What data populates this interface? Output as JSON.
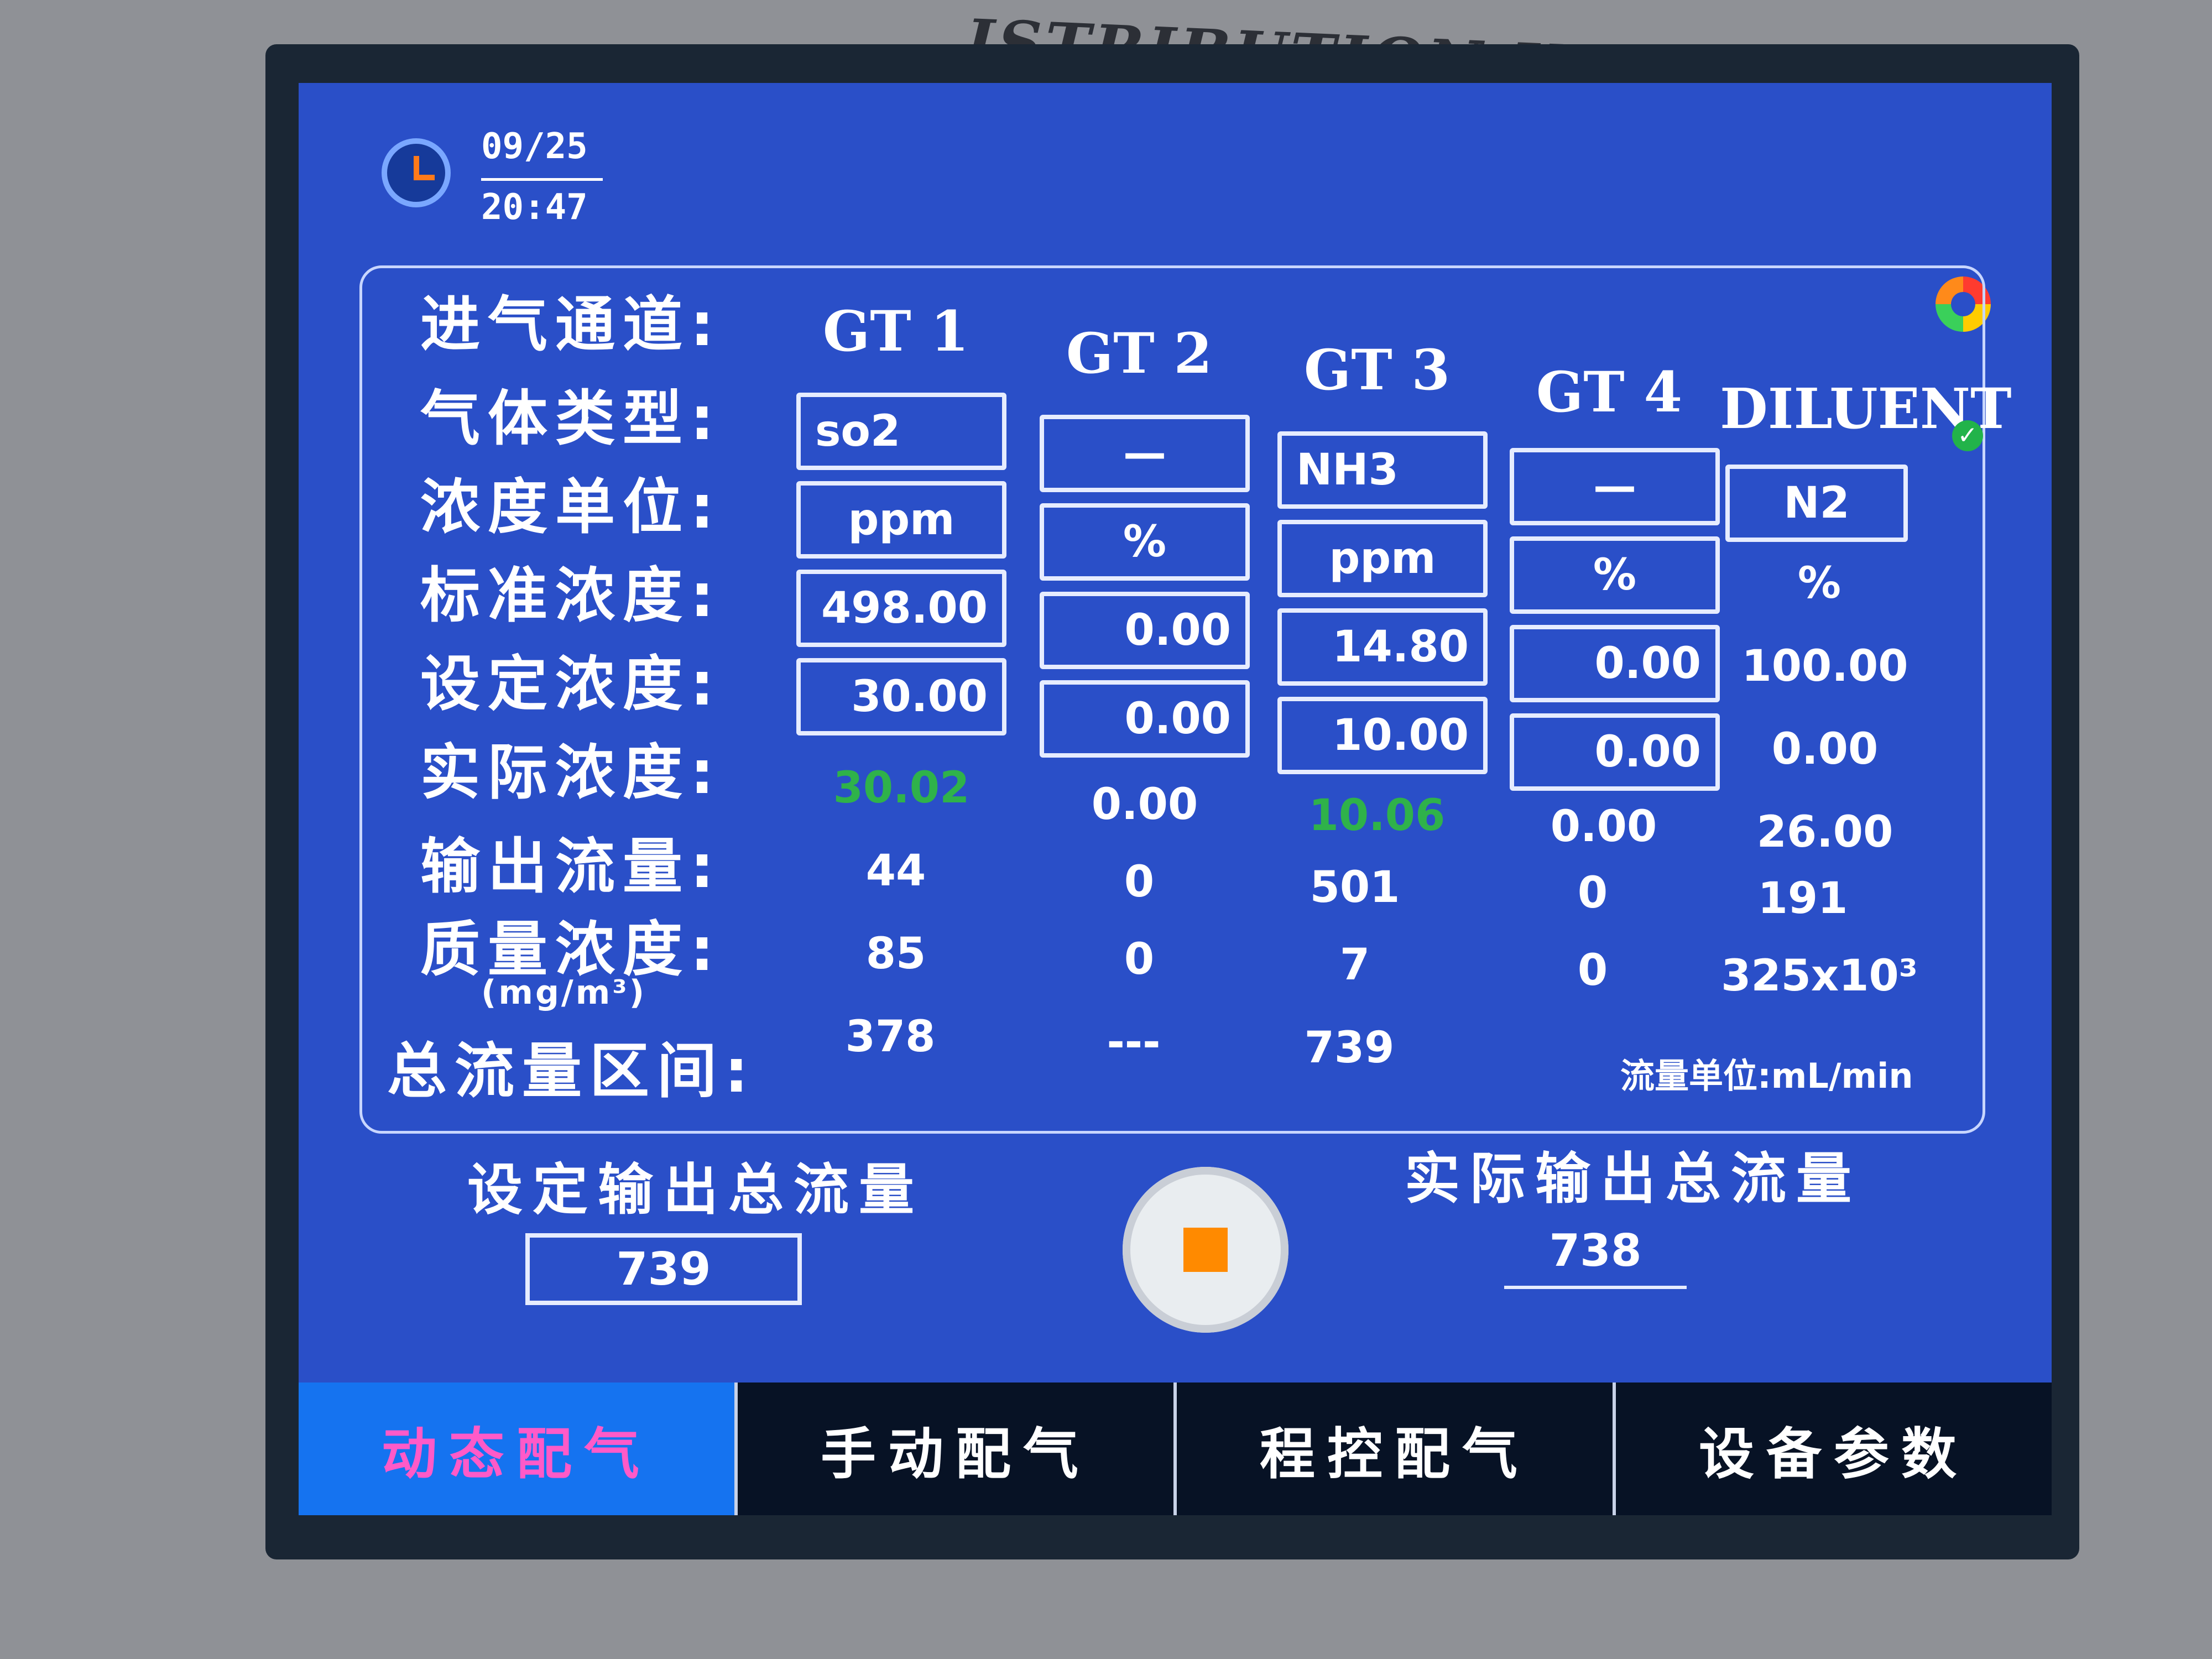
{
  "device": {
    "header_text": "ISTRIBUTION INSTRUMENT"
  },
  "status": {
    "date": "09/25",
    "time": "20:47"
  },
  "table": {
    "row_labels": {
      "channel": "进气通道:",
      "gas_type": "气体类型:",
      "unit": "浓度单位:",
      "std_conc": "标准浓度:",
      "set_conc": "设定浓度:",
      "act_conc": "实际浓度:",
      "flow": "输出流量:",
      "mass": "质量浓度:",
      "mass_unit": "(mg/m³)",
      "range": "总流量区间:"
    },
    "columns": [
      {
        "name": "GT 1",
        "gas": "so2",
        "unit": "ppm",
        "std": "498.00",
        "set": "30.00",
        "actual": "30.02",
        "flow": "44",
        "mass": "85",
        "range": "378"
      },
      {
        "name": "GT 2",
        "gas": "—",
        "unit": "%",
        "std": "0.00",
        "set": "0.00",
        "actual": "0.00",
        "flow": "0",
        "mass": "0",
        "range": "---"
      },
      {
        "name": "GT 3",
        "gas": "NH3",
        "unit": "ppm",
        "std": "14.80",
        "set": "10.00",
        "actual": "10.06",
        "flow": "501",
        "mass": "7",
        "range": "739"
      },
      {
        "name": "GT 4",
        "gas": "—",
        "unit": "%",
        "std": "0.00",
        "set": "0.00",
        "actual": "0.00",
        "flow": "0",
        "mass": "0"
      },
      {
        "name": "DILUENT",
        "gas": "N2",
        "unit": "%",
        "std": "100.00",
        "set": "0.00",
        "actual": "26.00",
        "flow": "191",
        "mass": "325x10³"
      }
    ],
    "flow_unit_note": "流量单位:mL/min"
  },
  "totals": {
    "set_label": "设定输出总流量",
    "set_value": "739",
    "actual_label": "实际输出总流量",
    "actual_value": "738"
  },
  "tabs": [
    {
      "label": "动态配气"
    },
    {
      "label": "手动配气"
    },
    {
      "label": "程控配气"
    },
    {
      "label": "设备参数"
    }
  ],
  "colors": {
    "screen": "#2a4fc8",
    "active_tab": "#1573f0",
    "active_tab_text": "#ff5ac8",
    "ok_value": "#2fb24a",
    "stop_square": "#ff8a00"
  },
  "icons": [
    "clock-icon",
    "status-logo-icon",
    "check-icon",
    "stop-icon"
  ]
}
